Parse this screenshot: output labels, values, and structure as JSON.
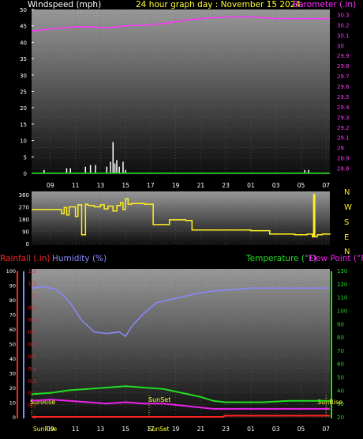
{
  "header": {
    "left_label": "Windspeed (mph)",
    "title": "24 hour graph day : November 15 2024",
    "right_label": "Barometer (.in)"
  },
  "colors": {
    "windspeed": "#ffffff",
    "barometer": "#ff33ff",
    "direction": "#ffee22",
    "humidity": "#8888ff",
    "temperature": "#22dd22",
    "dewpoint": "#ee22ee",
    "rainfall": "#ff2222",
    "sunmarker": "#dddd33"
  },
  "chart_data": [
    {
      "type": "line",
      "name": "wind-barometer",
      "x_ticks": [
        "09",
        "11",
        "13",
        "15",
        "17",
        "19",
        "21",
        "23",
        "01",
        "03",
        "05",
        "07"
      ],
      "y_left": {
        "label": "Windspeed (mph)",
        "ticks": [
          "0",
          "5",
          "10",
          "15",
          "20",
          "25",
          "30",
          "35",
          "40",
          "45",
          "50"
        ],
        "ylim": [
          0,
          50
        ]
      },
      "y_right": {
        "label": "Barometer (.in)",
        "ticks": [
          "28.8",
          "28.9",
          "29",
          "29.1",
          "29.2",
          "29.3",
          "29.4",
          "29.5",
          "29.6",
          "29.7",
          "29.8",
          "29.9",
          "30",
          "30.1",
          "30.2",
          "30.3"
        ],
        "ylim": [
          28.75,
          30.35
        ]
      },
      "xlim": [
        7.5,
        31.3
      ],
      "series": [
        {
          "name": "Barometer (.in)",
          "axis": "right",
          "x": [
            7.5,
            9,
            11,
            12.5,
            13.5,
            15,
            17,
            18.5,
            20,
            22,
            23.5,
            25,
            27,
            29,
            31.3
          ],
          "values": [
            30.14,
            30.16,
            30.18,
            30.18,
            30.17,
            30.19,
            30.2,
            30.22,
            30.25,
            30.27,
            30.28,
            30.28,
            30.26,
            30.26,
            30.26
          ]
        },
        {
          "name": "Windspeed (mph)",
          "axis": "left",
          "type": "bar",
          "x": [
            8.5,
            10.3,
            10.6,
            11.8,
            12.2,
            12.6,
            13.5,
            13.8,
            14.0,
            14.15,
            14.3,
            14.5,
            14.8,
            15.0,
            29.3,
            29.6
          ],
          "values": [
            1,
            1.5,
            1.5,
            2,
            2.5,
            2.5,
            2,
            3.5,
            9.5,
            3,
            4,
            2,
            3.5,
            1,
            1,
            1
          ]
        }
      ]
    },
    {
      "type": "line",
      "name": "wind-direction",
      "y_left": {
        "ticks": [
          "0",
          "90",
          "180",
          "270",
          "360"
        ],
        "ylim": [
          0,
          360
        ]
      },
      "y_right": {
        "labels": [
          "N",
          "W",
          "S",
          "E",
          "N"
        ]
      },
      "xlim": [
        7.5,
        31.3
      ],
      "series": [
        {
          "name": "Direction",
          "x": [
            7.5,
            9,
            9.9,
            10.1,
            10.3,
            10.5,
            11,
            11.2,
            11.5,
            11.8,
            12,
            12.5,
            13,
            13.3,
            13.6,
            14,
            14.3,
            14.6,
            14.8,
            15,
            15.2,
            15.5,
            16.5,
            17.2,
            18,
            18.5,
            19,
            19.8,
            20.3,
            21.5,
            22.5,
            23.5,
            25,
            26.5,
            27.5,
            28.5,
            29.5,
            29.9,
            30.0,
            30.1,
            30.3,
            30.7,
            31.3
          ],
          "values": [
            250,
            250,
            220,
            265,
            210,
            270,
            200,
            285,
            65,
            290,
            280,
            270,
            285,
            255,
            275,
            240,
            280,
            300,
            250,
            330,
            290,
            295,
            290,
            140,
            140,
            175,
            175,
            170,
            100,
            100,
            100,
            100,
            95,
            70,
            70,
            65,
            70,
            50,
            360,
            50,
            65,
            70,
            65
          ]
        }
      ]
    },
    {
      "type": "line",
      "name": "humidity-temperature",
      "legend": [
        "Rainfall (.in)",
        "Humidity (%)",
        "Temperature (°F)",
        "Dew Point (°F)"
      ],
      "y_rain": {
        "ticks": [
          "0",
          "0.1",
          "0.2",
          "0.3",
          "0.4",
          "0.5",
          "0.6",
          "0.7",
          "0.8",
          "0.9",
          "1",
          "1.1",
          "1.2"
        ],
        "ylim": [
          0,
          1.2
        ]
      },
      "y_humidity": {
        "ticks": [
          "0",
          "10",
          "20",
          "30",
          "40",
          "50",
          "60",
          "70",
          "80",
          "90",
          "100"
        ],
        "ylim": [
          0,
          100
        ]
      },
      "y_temp": {
        "ticks": [
          "20",
          "30",
          "40",
          "50",
          "60",
          "70",
          "80",
          "90",
          "100",
          "110",
          "120",
          "130"
        ],
        "ylim": [
          20,
          130
        ]
      },
      "x_ticks": [
        "09",
        "11",
        "13",
        "15",
        "17",
        "19",
        "21",
        "23",
        "01",
        "03",
        "05",
        "07"
      ],
      "xlim": [
        7.5,
        31.3
      ],
      "annotations": {
        "sunrise_label": "SunRise",
        "sunset_label": "SunSet",
        "sunrise_x": [
          7.5,
          31.0
        ],
        "sunset_x": [
          17.0
        ]
      },
      "series": [
        {
          "name": "Humidity (%)",
          "axis": "humidity",
          "x": [
            7.5,
            8.5,
            9.5,
            10.5,
            11.5,
            12.5,
            13.5,
            14.5,
            15.0,
            15.5,
            16.5,
            17.5,
            19,
            20.5,
            22,
            23.5,
            25,
            27,
            29,
            31.3
          ],
          "values": [
            88,
            89,
            87,
            79,
            66,
            58,
            57,
            58,
            55,
            62,
            71,
            78,
            81,
            84,
            86,
            87,
            88,
            88,
            88,
            88
          ]
        },
        {
          "name": "Temperature (°F)",
          "axis": "temp",
          "x": [
            7.5,
            9,
            10.5,
            12,
            13.5,
            15,
            16.5,
            18,
            19,
            20,
            21,
            22,
            23,
            24,
            26,
            28,
            31.3
          ],
          "values": [
            37,
            38,
            40,
            41,
            42,
            43,
            42,
            41,
            39,
            37,
            35,
            32,
            31,
            31,
            31,
            32,
            32
          ]
        },
        {
          "name": "Dew Point (°F)",
          "axis": "temp",
          "x": [
            7.5,
            9,
            10.5,
            12,
            13.5,
            15,
            16.5,
            18,
            19,
            20,
            21,
            22,
            23,
            24,
            26,
            28,
            31.3
          ],
          "values": [
            32,
            33,
            32,
            31,
            30,
            31,
            30,
            30,
            29,
            28,
            27,
            26,
            26,
            26,
            26,
            26,
            26
          ]
        },
        {
          "name": "Rainfall (.in)",
          "axis": "rain",
          "x": [
            7.5,
            22.8,
            22.9,
            31.3
          ],
          "values": [
            0,
            0,
            0.01,
            0.01
          ]
        }
      ]
    }
  ]
}
